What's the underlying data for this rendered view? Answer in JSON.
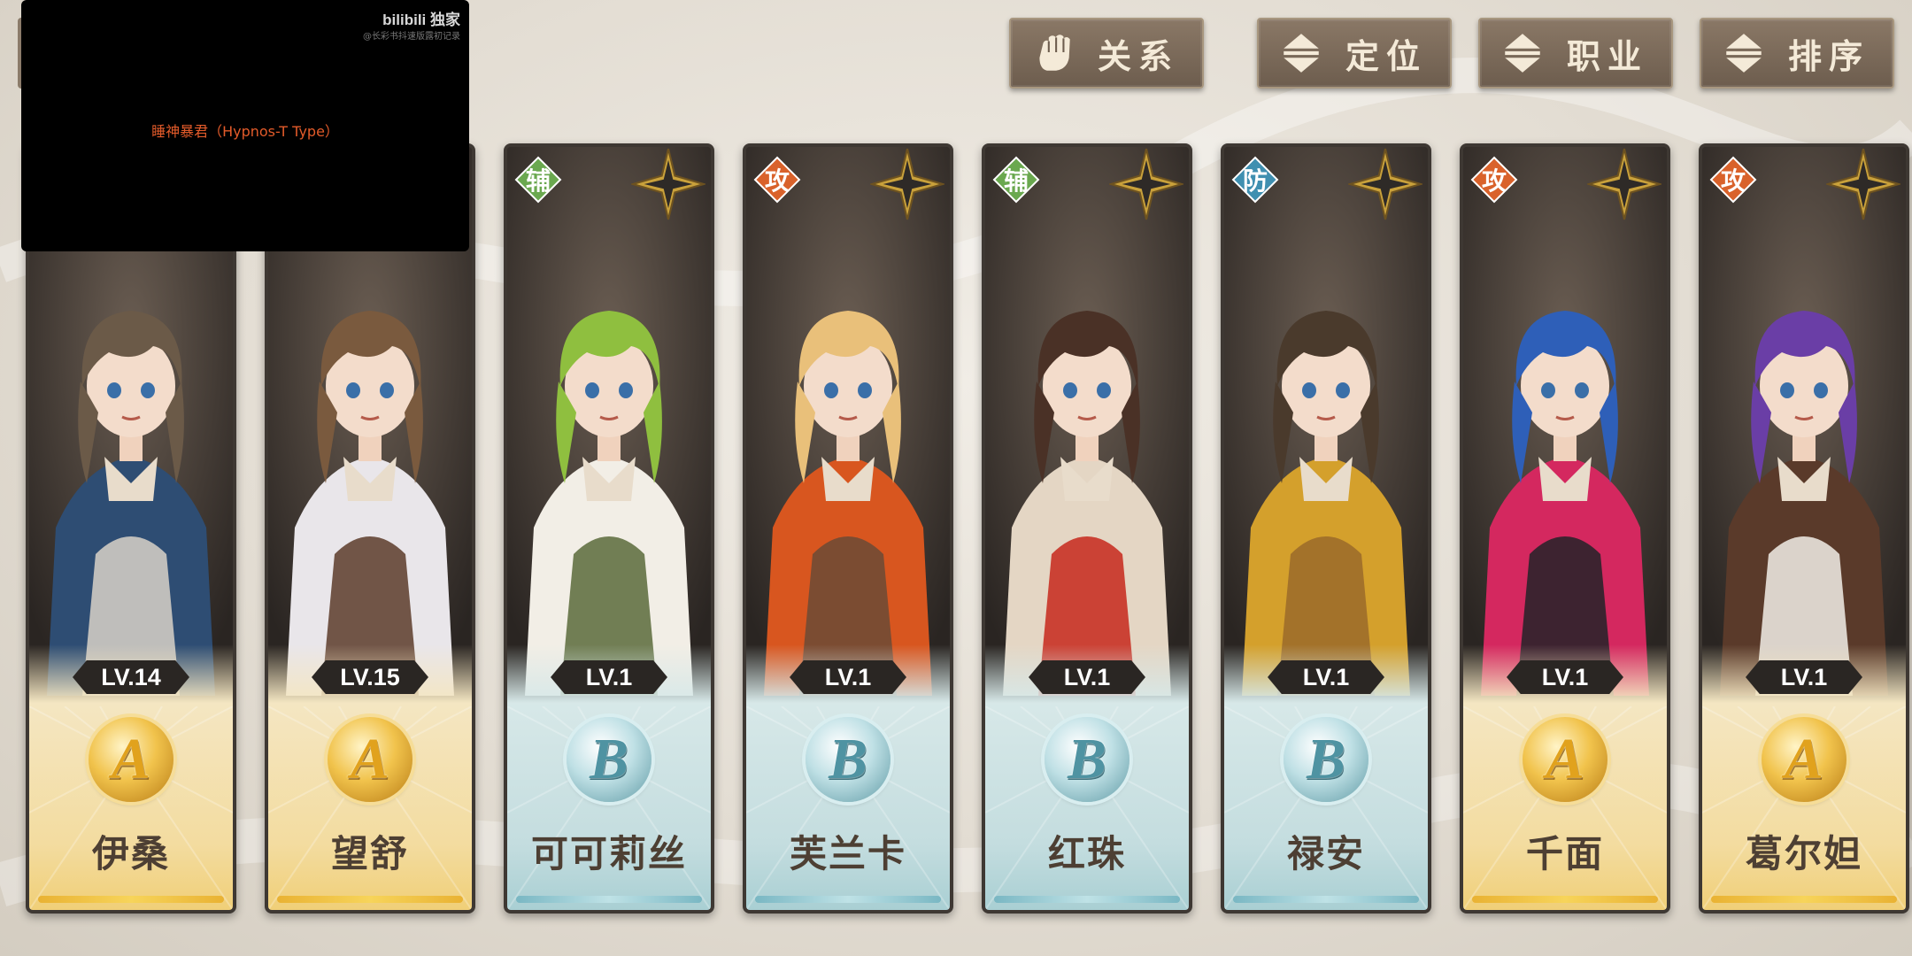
{
  "filters": [
    {
      "label": "关系",
      "icon": "fist-icon"
    },
    {
      "label": "定位",
      "icon": "sort-arrows-icon"
    },
    {
      "label": "职业",
      "icon": "sort-arrows-icon"
    },
    {
      "label": "排序",
      "icon": "sort-arrows-icon"
    }
  ],
  "overlay": {
    "logo": "bilibili 独家",
    "sub": "@长彩书抖速版露初记录",
    "caption": "睡神暴君（Hypnos-T Type）"
  },
  "characters": [
    {
      "name": "伊桑",
      "level": "LV.14",
      "grade": "A",
      "role": "",
      "role_color": "",
      "palette": [
        "#6b5a48",
        "#2e4d73",
        "#d8d2c8"
      ]
    },
    {
      "name": "望舒",
      "level": "LV.15",
      "grade": "A",
      "role": "",
      "role_color": "",
      "palette": [
        "#7a5a3e",
        "#e9e6ea",
        "#5c3b2a"
      ]
    },
    {
      "name": "可可莉丝",
      "level": "LV.1",
      "grade": "B",
      "role": "辅",
      "role_color": "#6aa84f",
      "palette": [
        "#8fbf3f",
        "#f2eee6",
        "#5b6a3a"
      ]
    },
    {
      "name": "芙兰卡",
      "level": "LV.1",
      "grade": "B",
      "role": "攻",
      "role_color": "#d9622b",
      "palette": [
        "#e9c07a",
        "#d8561f",
        "#6b4a36"
      ]
    },
    {
      "name": "红珠",
      "level": "LV.1",
      "grade": "B",
      "role": "辅",
      "role_color": "#6aa84f",
      "palette": [
        "#4a3126",
        "#e4d6c4",
        "#c7281c"
      ]
    },
    {
      "name": "禄安",
      "level": "LV.1",
      "grade": "B",
      "role": "防",
      "role_color": "#3f8fb0",
      "palette": [
        "#4a3a2c",
        "#d4a02c",
        "#9a6a2a"
      ]
    },
    {
      "name": "千面",
      "level": "LV.1",
      "grade": "A",
      "role": "攻",
      "role_color": "#d9622b",
      "palette": [
        "#2e5fb8",
        "#d4285f",
        "#222228"
      ]
    },
    {
      "name": "葛尔妲",
      "level": "LV.1",
      "grade": "A",
      "role": "攻",
      "role_color": "#d9622b",
      "palette": [
        "#6a3ea6",
        "#5a3a2a",
        "#f2eee8"
      ]
    }
  ]
}
